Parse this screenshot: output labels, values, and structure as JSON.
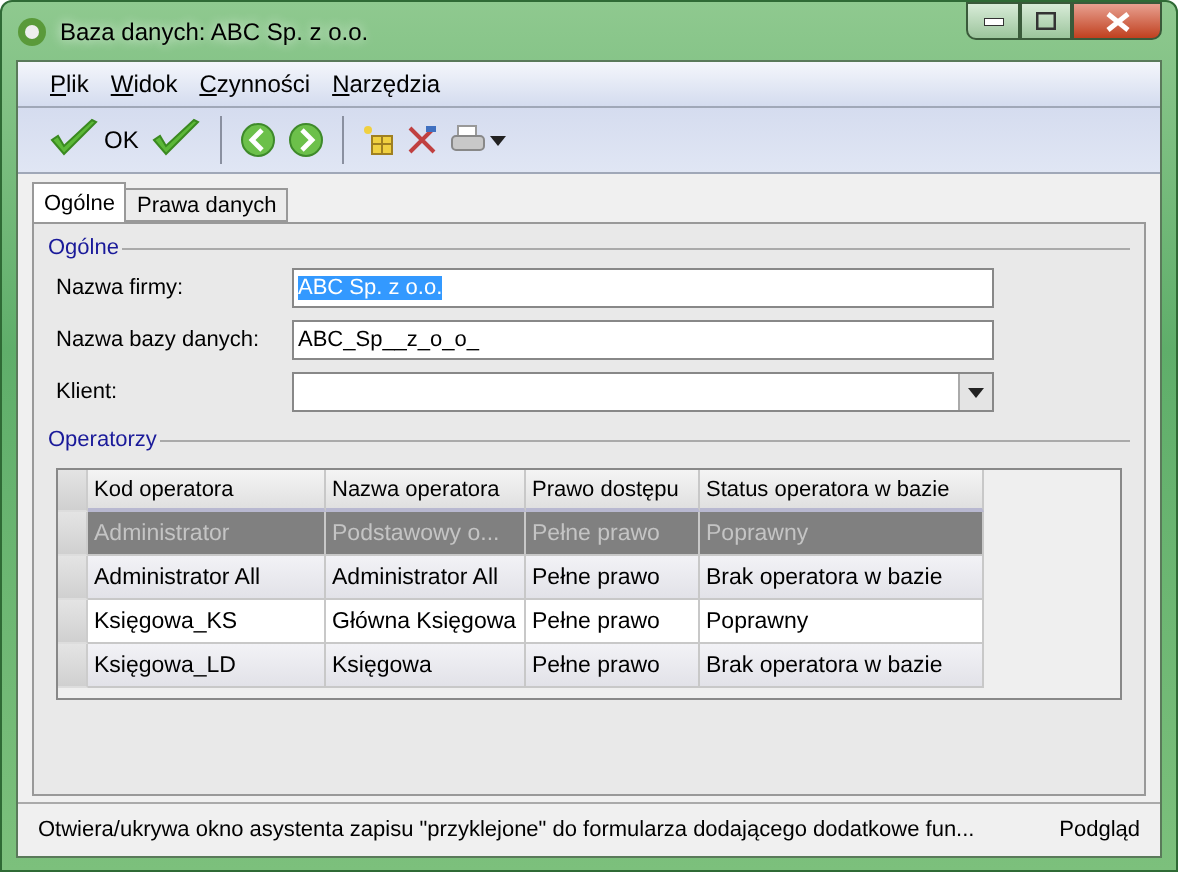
{
  "window": {
    "title": "Baza danych: ABC Sp. z o.o."
  },
  "menu": [
    "Plik",
    "Widok",
    "Czynności",
    "Narzędzia"
  ],
  "toolbar": {
    "ok_label": "OK"
  },
  "tabs": [
    {
      "label": "Ogólne",
      "selected": true
    },
    {
      "label": "Prawa danych",
      "selected": false
    }
  ],
  "general": {
    "title": "Ogólne",
    "fields": [
      {
        "label": "Nazwa firmy:",
        "value": "ABC Sp. z o.o.",
        "kind": "text",
        "highlighted": true
      },
      {
        "label": "Nazwa bazy danych:",
        "value": "ABC_Sp__z_o_o_",
        "kind": "text",
        "highlighted": false
      },
      {
        "label": "Klient:",
        "kind": "dropdown"
      }
    ]
  },
  "operators": {
    "title": "Operatorzy",
    "columns": [
      "Kod operatora",
      "Nazwa operatora",
      "Prawo dostępu",
      "Status operatora w bazie"
    ],
    "rows": [
      {
        "cells": [
          "Administrator",
          "Podstawowy o...",
          "Pełne prawo",
          "Poprawny"
        ],
        "selected": true
      },
      {
        "cells": [
          "Administrator All",
          "Administrator All",
          "Pełne prawo",
          "Brak operatora w bazie"
        ],
        "selected": false
      },
      {
        "cells": [
          "Księgowa_KS",
          "Główna Księgowa",
          "Pełne prawo",
          "Poprawny"
        ],
        "selected": false
      },
      {
        "cells": [
          "Księgowa_LD",
          "Księgowa",
          "Pełne prawo",
          "Brak operatora w bazie"
        ],
        "selected": false
      }
    ]
  },
  "status_bar": {
    "message": "Otwiera/ukrywa okno asystenta zapisu \"przyklejone\" do formularza dodającego dodatkowe fun...",
    "mode": "Podgląd"
  }
}
